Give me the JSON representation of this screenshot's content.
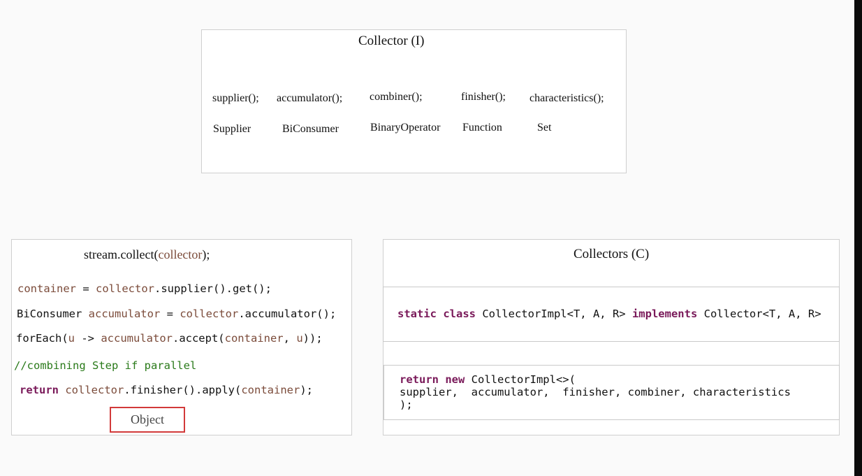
{
  "collector_interface": {
    "title": "Collector (I)",
    "methods": [
      "supplier();",
      "accumulator();",
      "combiner();",
      "finisher();",
      "characteristics();"
    ],
    "types": [
      "Supplier",
      "BiConsumer",
      "BinaryOperator",
      "Function",
      "Set"
    ]
  },
  "stream_collect": {
    "title_prefix": "stream.collect(",
    "title_arg": "collector",
    "title_suffix": ");",
    "line1": {
      "a": "container",
      "b": " = ",
      "c": "collector",
      "d": ".supplier().get();"
    },
    "line2": {
      "a": "BiConsumer ",
      "b": "accumulator",
      "c": " = ",
      "d": "collector",
      "e": ".accumulator();"
    },
    "line3": {
      "a": "forEach(",
      "b": "u",
      "c": " -> ",
      "d": "accumulator",
      "e": ".accept(",
      "f": "container",
      "g": ", ",
      "h": "u",
      "i": "));"
    },
    "comment": "//combining Step if parallel",
    "line5": {
      "kw": "return",
      "sp": " ",
      "a": "collector",
      "b": ".finisher().apply(",
      "c": "container",
      "d": ");"
    },
    "result_label": "Object"
  },
  "collectors_class": {
    "title": "Collectors (C)",
    "impl_line": {
      "kw1": "static class",
      "a": " CollectorImpl<T, A, R> ",
      "kw2": "implements",
      "b": " Collector<T, A, R>"
    },
    "return_block": {
      "kw": "return new",
      "line1_rest": " CollectorImpl<>(",
      "line2": "supplier,  accumulator,  finisher, combiner, characteristics",
      "line3": ");"
    }
  },
  "colors": {
    "keyword": "#7a1a5a",
    "variable": "#7b4b3a",
    "comment": "#2a7a1a",
    "highlight_border": "#d23a3a"
  }
}
